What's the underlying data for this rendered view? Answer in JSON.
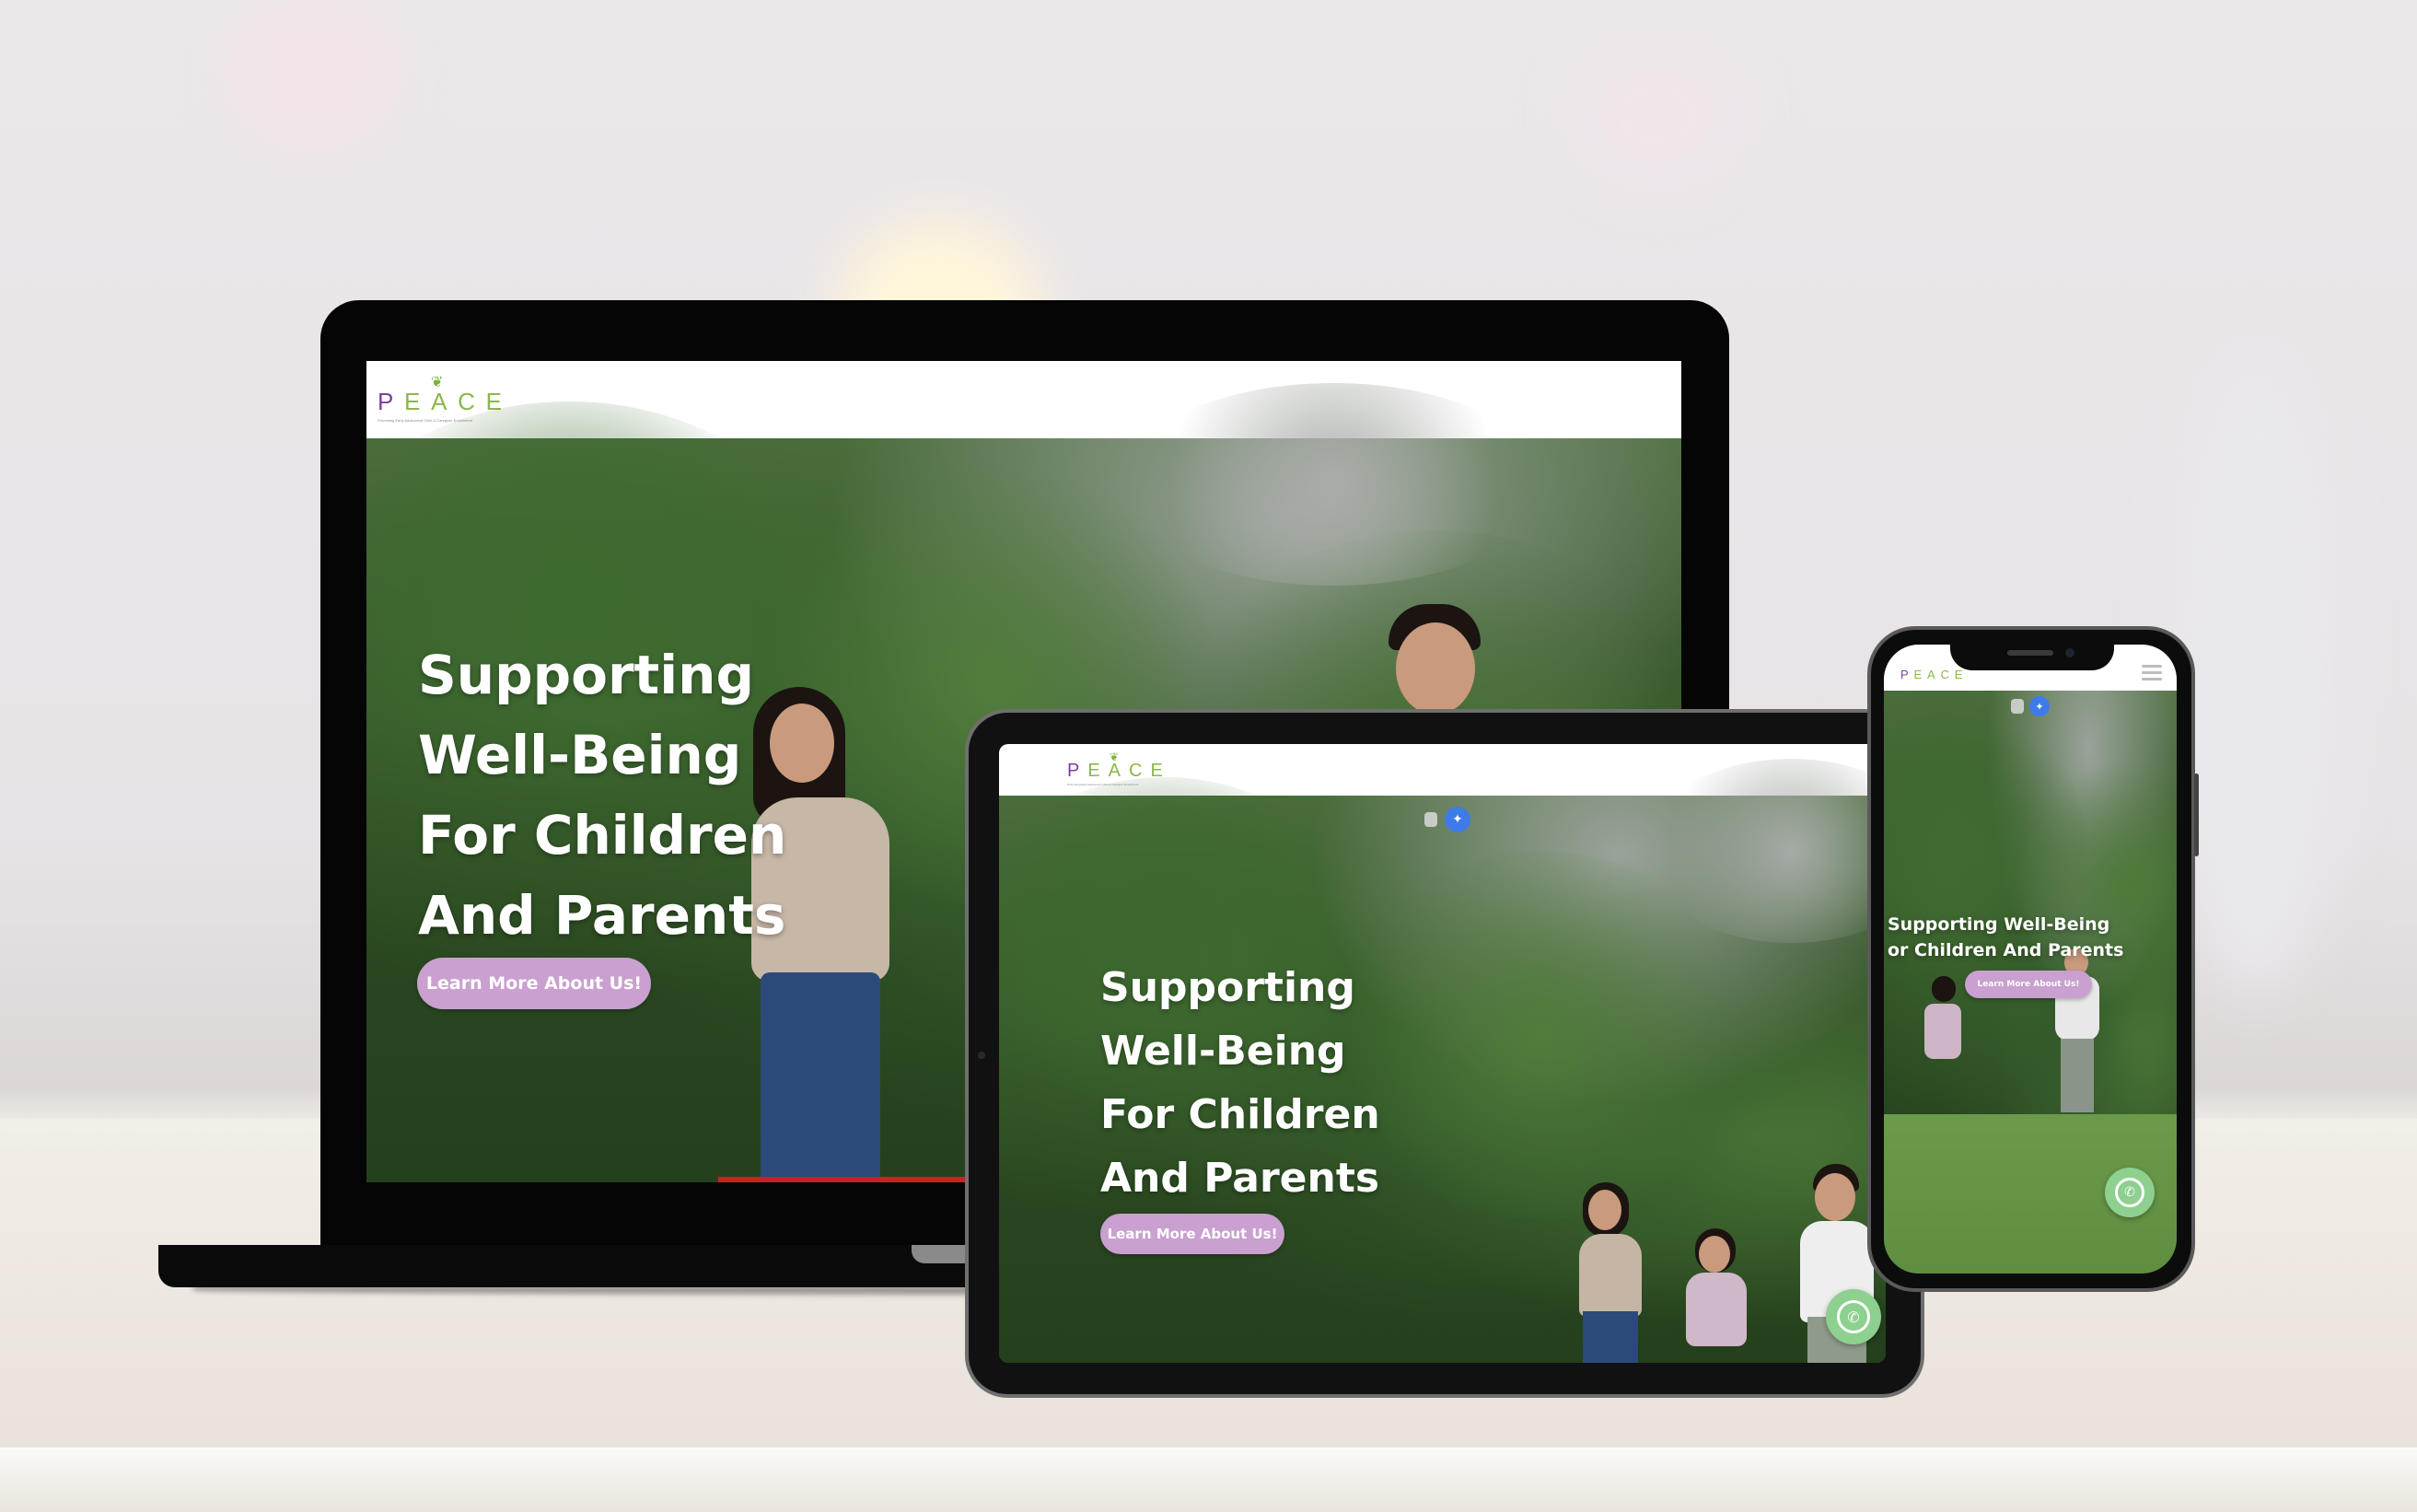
{
  "brand": {
    "logo": "PEACE",
    "logo_first": "P",
    "logo_rest": "EACE",
    "tagline": "Promoting Early Adolescent Child & Caregiver Enrichment"
  },
  "hero": {
    "title_lines": [
      "Supporting",
      "Well-Being",
      "For Children",
      "And Parents"
    ],
    "cta_label": "Learn More About Us!"
  },
  "phone": {
    "title_lines": [
      "Supporting Well-Being",
      "or Children And Parents"
    ]
  },
  "icons": {
    "whatsapp": "whatsapp-icon",
    "menu": "hamburger-menu-icon",
    "accessibility": "accessibility-icon",
    "copy": "copy-icon"
  },
  "colors": {
    "brand_purple": "#7b3fa0",
    "brand_green": "#8ab84a",
    "cta": "#c9a0cf",
    "whatsapp": "#8dd08f"
  }
}
